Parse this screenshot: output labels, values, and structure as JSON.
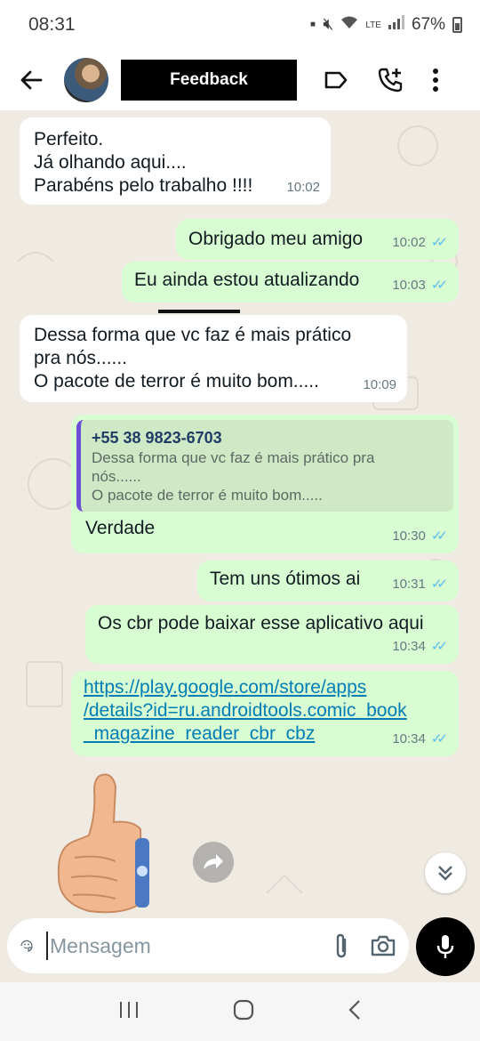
{
  "status_bar": {
    "time": "08:31",
    "network": "LTE",
    "battery": "67%"
  },
  "header": {
    "title": "Feedback",
    "icons": [
      "back-arrow-icon",
      "label-icon",
      "add-call-icon",
      "more-vert-icon"
    ]
  },
  "messages": [
    {
      "direction": "in",
      "text": "Perfeito.\nJá olhando aqui....\nParabéns pelo trabalho !!!!",
      "time": "10:02"
    },
    {
      "direction": "out",
      "text": "Obrigado meu amigo",
      "time": "10:02",
      "status": "read"
    },
    {
      "direction": "out",
      "text": "Eu ainda estou atualizando",
      "time": "10:03",
      "status": "read"
    },
    {
      "direction": "in",
      "text": "Dessa forma que vc faz é mais prático\npra nós......\nO pacote de terror é muito bom.....",
      "time": "10:09"
    },
    {
      "direction": "out",
      "quote_name": "+55 38 9823-6703",
      "quote_text": "Dessa forma que vc faz é mais prático pra\nnós......\nO pacote de terror é muito bom.....",
      "text": "Verdade",
      "time": "10:30",
      "status": "read"
    },
    {
      "direction": "out",
      "text": "Tem uns ótimos ai",
      "time": "10:31",
      "status": "read"
    },
    {
      "direction": "out",
      "text": "Os cbr pode baixar esse aplicativo aqui",
      "time": "10:34",
      "status": "read"
    },
    {
      "direction": "out",
      "link": "https://play.google.com/store/apps\n/details?id=ru.androidtools.comic_book\n_magazine_reader_cbr_cbz",
      "time": "10:34",
      "status": "read"
    }
  ],
  "sticker": "thumbs-up-sticker",
  "input": {
    "placeholder": "Mensagem"
  },
  "colors": {
    "outgoing_bubble": "#d9fdd3",
    "incoming_bubble": "#ffffff",
    "chat_background": "#efeae2",
    "read_ticks": "#53bdeb",
    "link": "#027eb5"
  }
}
